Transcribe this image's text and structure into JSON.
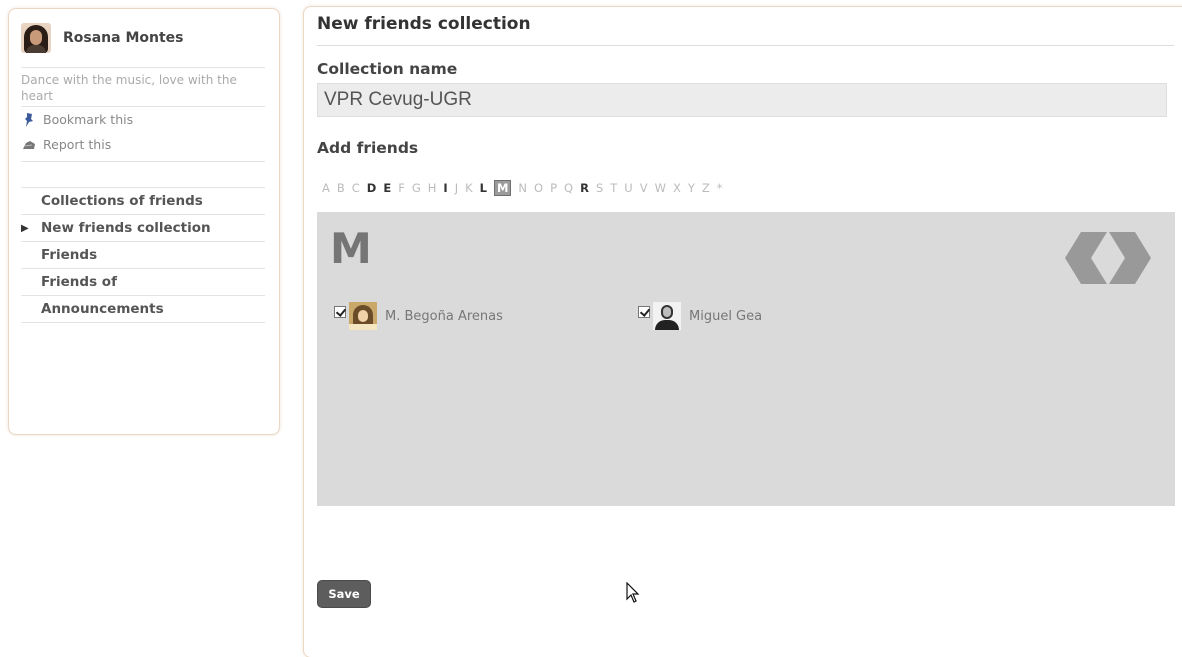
{
  "sidebar": {
    "profile_name": "Rosana Montes",
    "status": "Dance with the music, love with the heart",
    "actions": [
      {
        "label": "Bookmark this",
        "icon": "pushpin-icon"
      },
      {
        "label": "Report this",
        "icon": "report-icon"
      }
    ],
    "nav": [
      {
        "label": "Collections of friends",
        "active": false
      },
      {
        "label": "New friends collection",
        "active": true
      },
      {
        "label": "Friends",
        "active": false
      },
      {
        "label": "Friends of",
        "active": false
      },
      {
        "label": "Announcements",
        "active": false
      }
    ],
    "active_marker": "▶"
  },
  "main": {
    "title": "New friends collection",
    "collection_name_label": "Collection name",
    "collection_name_value": "VPR Cevug-UGR",
    "add_friends_label": "Add friends",
    "alphabet": [
      {
        "letter": "A",
        "style": "dim"
      },
      {
        "letter": "B",
        "style": "dim"
      },
      {
        "letter": "C",
        "style": "dim"
      },
      {
        "letter": "D",
        "style": "bold"
      },
      {
        "letter": "E",
        "style": "bold"
      },
      {
        "letter": "F",
        "style": "dim"
      },
      {
        "letter": "G",
        "style": "dim"
      },
      {
        "letter": "H",
        "style": "dim"
      },
      {
        "letter": "I",
        "style": "bold"
      },
      {
        "letter": "J",
        "style": "dim"
      },
      {
        "letter": "K",
        "style": "dim"
      },
      {
        "letter": "L",
        "style": "bold"
      },
      {
        "letter": "M",
        "style": "active"
      },
      {
        "letter": "N",
        "style": "dim"
      },
      {
        "letter": "O",
        "style": "dim"
      },
      {
        "letter": "P",
        "style": "dim"
      },
      {
        "letter": "Q",
        "style": "dim"
      },
      {
        "letter": "R",
        "style": "bold"
      },
      {
        "letter": "S",
        "style": "dim"
      },
      {
        "letter": "T",
        "style": "dim"
      },
      {
        "letter": "U",
        "style": "dim"
      },
      {
        "letter": "V",
        "style": "dim"
      },
      {
        "letter": "W",
        "style": "dim"
      },
      {
        "letter": "X",
        "style": "dim"
      },
      {
        "letter": "Y",
        "style": "dim"
      },
      {
        "letter": "Z",
        "style": "dim"
      },
      {
        "letter": "*",
        "style": "dim"
      }
    ],
    "current_letter": "M",
    "friends": [
      {
        "name": "M. Begoña Arenas",
        "checked": true
      },
      {
        "name": "Miguel Gea",
        "checked": true
      }
    ],
    "save_label": "Save"
  },
  "colors": {
    "panel_border": "#ead8c4",
    "letter_panel_bg": "#dadada",
    "save_button_bg": "#5d5d5d",
    "active_letter_bg": "#9b9b9b"
  }
}
